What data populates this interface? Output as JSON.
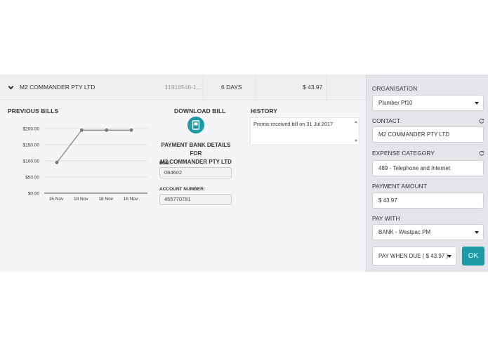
{
  "bill_row": {
    "contact": "M2 COMMANDER PTY LTD",
    "reference": "11918546-1...",
    "due": "6 DAYS",
    "amount": "$ 43.97"
  },
  "previous_bills": {
    "title": "PREVIOUS BILLS"
  },
  "chart_data": {
    "type": "line",
    "title": "PREVIOUS BILLS",
    "xlabel": "",
    "ylabel": "",
    "categories": [
      "15 Nov",
      "18 Nov",
      "18 Nov",
      "18 Nov"
    ],
    "values": [
      95,
      195,
      195,
      195
    ],
    "y_ticks": [
      "$0.00",
      "$50.00",
      "$100.00",
      "$150.00",
      "$200.00"
    ],
    "ylim": [
      0,
      200
    ],
    "grid": true,
    "line_color": "#8a8a8a"
  },
  "download": {
    "title": "DOWNLOAD BILL",
    "icon": "document-download-icon"
  },
  "bank_details": {
    "title_line1": "PAYMENT BANK DETAILS FOR",
    "title_line2": "M2 COMMANDER PTY LTD",
    "bsb_label": "BSB:",
    "bsb_value": "084602",
    "account_label": "ACCOUNT NUMBER:",
    "account_value": "455770781"
  },
  "history": {
    "title": "HISTORY",
    "entries": [
      "Promis received bill on 31 Jul 2017"
    ]
  },
  "sidebar": {
    "organisation_label": "ORGANISATION",
    "organisation_value": "Plumber Pf10",
    "contact_label": "CONTACT",
    "contact_value": "M2 COMMANDER PTY LTD",
    "expense_label": "EXPENSE CATEGORY",
    "expense_value": "489 - Telephone and Internet",
    "payment_amount_label": "PAYMENT AMOUNT",
    "payment_amount_value": "$ 43.97",
    "pay_with_label": "PAY WITH",
    "pay_with_value": "BANK - Westpac PM",
    "pay_when_value": "PAY WHEN DUE ( $ 43.97 )",
    "ok_label": "OK"
  },
  "colors": {
    "accent": "#1c9aa5",
    "panel": "#f5f5f7",
    "sidebar": "#e5e5e9"
  }
}
